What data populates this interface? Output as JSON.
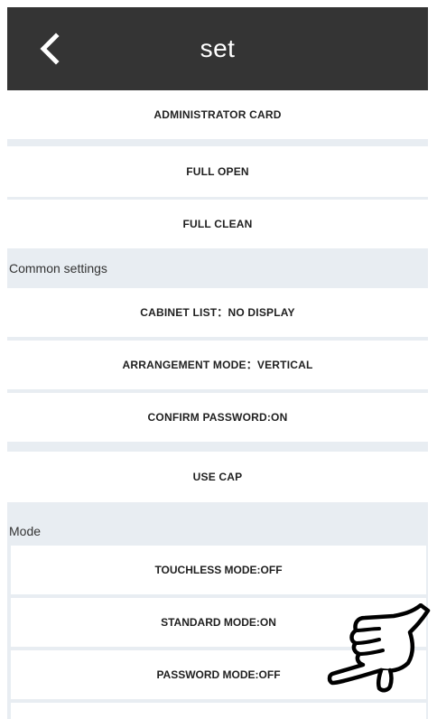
{
  "header": {
    "title": "set",
    "back_icon": "chevron-left-icon"
  },
  "top_items": [
    {
      "label": "ADMINISTRATOR CARD"
    },
    {
      "label": "FULL OPEN"
    },
    {
      "label": "FULL CLEAN"
    }
  ],
  "common_settings": {
    "heading": "Common settings",
    "items": [
      {
        "label": "CABINET LIST：NO DISPLAY"
      },
      {
        "label": "ARRANGEMENT MODE：VERTICAL"
      },
      {
        "label": "CONFIRM PASSWORD:ON"
      },
      {
        "label": "USE CAP"
      }
    ]
  },
  "mode": {
    "heading": "Mode",
    "items": [
      {
        "label": "TOUCHLESS MODE:OFF"
      },
      {
        "label": "STANDARD MODE:ON"
      },
      {
        "label": "PASSWORD MODE:OFF"
      }
    ]
  },
  "overlay": {
    "icon": "pointing-hand-icon"
  },
  "colors": {
    "header_bg": "#343434",
    "page_bg": "#e8edf2",
    "row_bg": "#ffffff"
  }
}
